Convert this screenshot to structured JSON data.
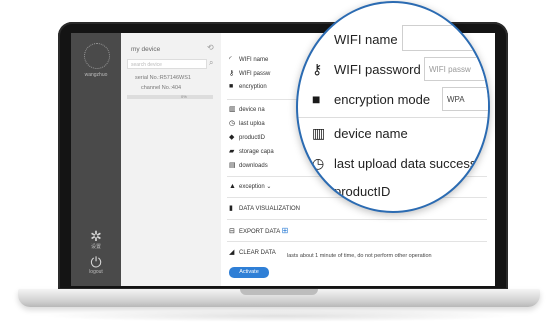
{
  "sidebar": {
    "brand": "wangzhuo",
    "settings_label": "设置",
    "logout_label": "logout"
  },
  "device_list": {
    "title": "my device",
    "search_placeholder": "search device",
    "serial": "serial No.:R57146WS1",
    "channel": "channel No.:404",
    "progress_label": "0%",
    "progress": 0
  },
  "fields": [
    {
      "icon": "wifi-icon",
      "label": "WIFI name"
    },
    {
      "icon": "key-icon",
      "label": "WIFI passw"
    },
    {
      "icon": "lock-icon",
      "label": "encryption"
    },
    {
      "icon": "barcode-icon",
      "label": "device na"
    },
    {
      "icon": "timer-icon",
      "label": "last uploa"
    },
    {
      "icon": "tag-icon",
      "label": "productID"
    },
    {
      "icon": "storage-icon",
      "label": "storage capa"
    },
    {
      "icon": "download-icon",
      "label": "downloads"
    }
  ],
  "actions": {
    "exception": "exception",
    "data_visualization": "DATA VISUALIZATION",
    "export_data": "EXPORT DATA",
    "clear_data": "CLEAR DATA",
    "clear_note": "lasts about 1 minute of time, do not perform other operation",
    "activate": "Activate"
  },
  "magnifier": {
    "wifi_name": "WIFI name",
    "wifi_password": "WIFI password",
    "wifi_password_value": "WIFI passw",
    "encryption_mode": "encryption mode",
    "encryption_value": "WPA",
    "device_name": "device name",
    "last_upload": "last upload data success",
    "product_id": "productID"
  },
  "colors": {
    "accent": "#2f7fd6",
    "magnifier_border": "#2b6bb2",
    "sidebar": "#4a4a4a"
  }
}
